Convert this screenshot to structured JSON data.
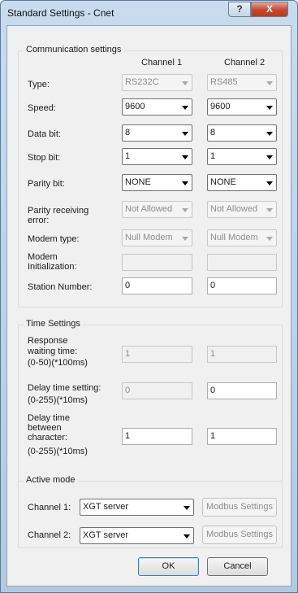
{
  "window": {
    "title": "Standard Settings - Cnet",
    "help_label": "?",
    "close_label": "X"
  },
  "communication": {
    "group_title": "Communication settings",
    "channel1_header": "Channel 1",
    "channel2_header": "Channel 2",
    "type": {
      "label": "Type:",
      "ch1": "RS232C",
      "ch2": "RS485"
    },
    "speed": {
      "label": "Speed:",
      "ch1": "9600",
      "ch2": "9600"
    },
    "data_bit": {
      "label": "Data bit:",
      "ch1": "8",
      "ch2": "8"
    },
    "stop_bit": {
      "label": "Stop bit:",
      "ch1": "1",
      "ch2": "1"
    },
    "parity_bit": {
      "label": "Parity bit:",
      "ch1": "NONE",
      "ch2": "NONE"
    },
    "parity_error": {
      "label_line1": "Parity receiving",
      "label_line2": "error:",
      "ch1": "Not Allowed",
      "ch2": "Not Allowed"
    },
    "modem_type": {
      "label": "Modem type:",
      "ch1": "Null Modem",
      "ch2": "Null Modem"
    },
    "modem_init": {
      "label_line1": "Modem",
      "label_line2": "Initialization:",
      "ch1": "",
      "ch2": ""
    },
    "station_number": {
      "label": "Station Number:",
      "ch1": "0",
      "ch2": "0"
    }
  },
  "time": {
    "group_title": "Time Settings",
    "response": {
      "label_line1": "Response",
      "label_line2": "waiting time:",
      "label_line3": "(0-50)(*100ms)",
      "ch1": "1",
      "ch2": "1"
    },
    "delay": {
      "label_line1": "Delay time setting:",
      "label_line2": "(0-255)(*10ms)",
      "ch1": "0",
      "ch2": "0"
    },
    "delay_between": {
      "label_line1": "Delay time",
      "label_line2": "between",
      "label_line3": "character:",
      "label_line4": "(0-255)(*10ms)",
      "ch1": "1",
      "ch2": "1"
    }
  },
  "active": {
    "group_title": "Active mode",
    "ch1_label": "Channel 1:",
    "ch1_value": "XGT server",
    "ch2_label": "Channel 2:",
    "ch2_value": "XGT server",
    "modbus_label": "Modbus Settings"
  },
  "buttons": {
    "ok": "OK",
    "cancel": "Cancel"
  }
}
